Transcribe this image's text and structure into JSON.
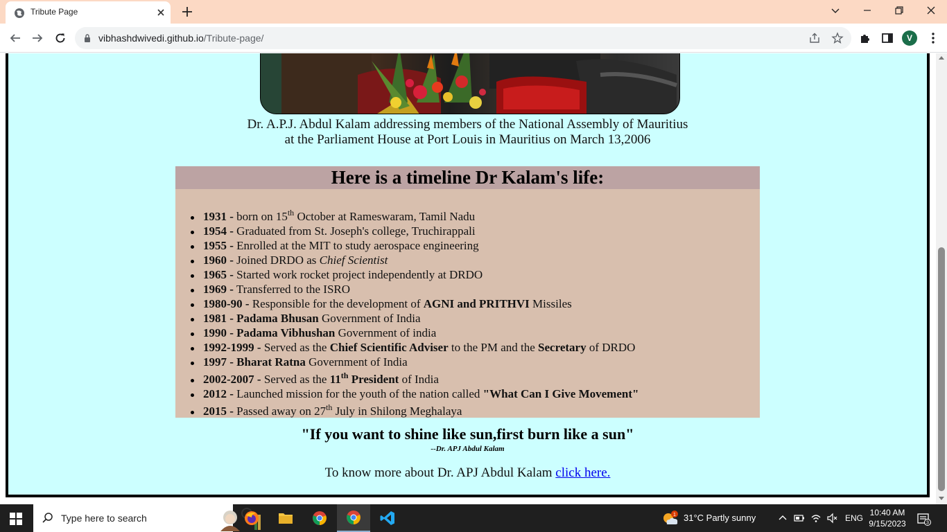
{
  "browser": {
    "tab_title": "Tribute Page",
    "url_host": "vibhashdwivedi.github.io",
    "url_path": "/Tribute-page/",
    "profile_initial": "V"
  },
  "page": {
    "caption_line1": "Dr. A.P.J. Abdul Kalam addressing members of the National Assembly of Mauritius",
    "caption_line2": "at the Parliament House at Port Louis in Mauritius on March 13,2006",
    "timeline_heading": "Here is a timeline Dr Kalam's life:",
    "timeline": [
      {
        "year": "1931 -",
        "t1": "born on 15",
        "sup": "th",
        "t2": " October at Rameswaram, Tamil Nadu"
      },
      {
        "year": "1954 -",
        "t1": "Graduated from St. Joseph's college, Truchirappali"
      },
      {
        "year": "1955 -",
        "t1": "Enrolled at the MIT to study aerospace engineering"
      },
      {
        "year": "1960 -",
        "t1": "Joined DRDO as ",
        "em": "Chief Scientist"
      },
      {
        "year": "1965 -",
        "t1": "Started work rocket project independently at DRDO"
      },
      {
        "year": "1969 -",
        "t1": "Transferred to the ISRO"
      },
      {
        "year": "1980-90 -",
        "t1": "Responsible for the development of ",
        "b1": "AGNI and PRITHVI",
        "t2": " Missiles"
      },
      {
        "year": "1981 -",
        "b1": "Padama Bhusan",
        "t2": " Government of India"
      },
      {
        "year": "1990 -",
        "b1": "Padama Vibhushan",
        "t2": " Government of india"
      },
      {
        "year": "1992-1999 -",
        "t1": "Served as the ",
        "b1": "Chief Scientific Adviser",
        "t2": " to the PM and the ",
        "b2": "Secretary",
        "t3": " of DRDO"
      },
      {
        "year": "1997 -",
        "b1": "Bharat Ratna",
        "t2": " Government of India"
      },
      {
        "year": "2002-2007 -",
        "t1": "Served as the ",
        "b1": "11",
        "bsup": "th",
        "b2": " President",
        "t2": " of India"
      },
      {
        "year": "2012 -",
        "t1": "Launched mission for the youth of the nation called ",
        "b1": "\"What Can I Give Movement\""
      },
      {
        "year": "2015 -",
        "t1": "Passed away on 27",
        "sup": "th",
        "t2": " July in Shilong Meghalaya"
      }
    ],
    "quote": "\"If you want to shine like sun,first burn like a sun\"",
    "quote_author": "--Dr. APJ Abdul Kalam",
    "more_text": "To know more about Dr. APJ Abdul Kalam ",
    "more_link": "click here."
  },
  "taskbar": {
    "search_placeholder": "Type here to search",
    "weather": "31°C  Partly sunny",
    "language": "ENG",
    "time": "10:40 AM",
    "date": "9/15/2023",
    "notification_count": "3",
    "weather_badge": "1"
  },
  "colors": {
    "tab_strip": "#fcd9c4",
    "page_background": "#ccffff",
    "timeline_background": "#d8bfae",
    "timeline_heading_background": "#bca3a3",
    "link": "#0000ee"
  }
}
